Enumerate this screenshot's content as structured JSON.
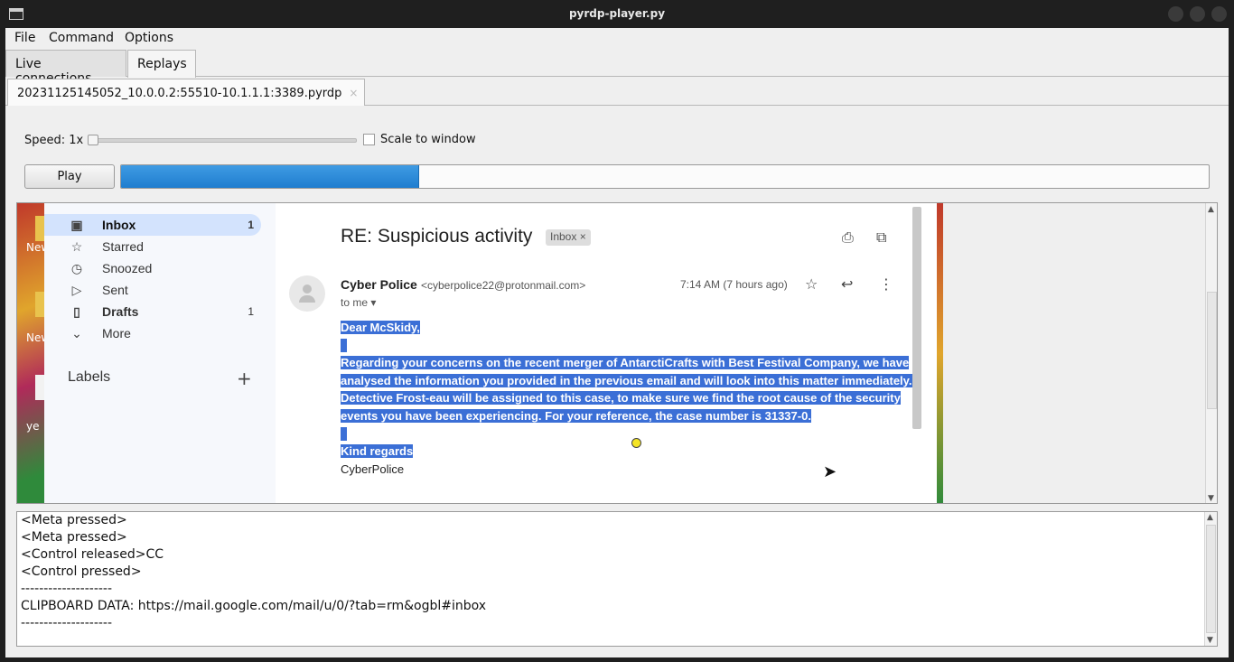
{
  "window": {
    "title": "pyrdp-player.py"
  },
  "menu": {
    "file": "File",
    "command": "Command",
    "options": "Options"
  },
  "tabs": {
    "live": "Live connections",
    "replays": "Replays"
  },
  "file_tab": {
    "name": "20231125145052_10.0.0.2:55510-10.1.1.1:3389.pyrdp",
    "close": "×"
  },
  "controls": {
    "speed_label": "Speed: 1x",
    "speed_value": 1,
    "scale_label": "Scale to window",
    "scale_checked": false,
    "play_label": "Play",
    "progress_fraction": 0.274
  },
  "gmail": {
    "nav": [
      {
        "label": "Inbox",
        "count": "1",
        "icon": "inbox-icon",
        "selected": true
      },
      {
        "label": "Starred",
        "count": "",
        "icon": "star-icon",
        "selected": false
      },
      {
        "label": "Snoozed",
        "count": "",
        "icon": "clock-icon",
        "selected": false
      },
      {
        "label": "Sent",
        "count": "",
        "icon": "send-icon",
        "selected": false
      },
      {
        "label": "Drafts",
        "count": "1",
        "icon": "draft-icon",
        "selected": false
      },
      {
        "label": "More",
        "count": "",
        "icon": "chevron-down-icon",
        "selected": false
      }
    ],
    "labels_title": "Labels",
    "subject": "RE: Suspicious activity",
    "chip": "Inbox",
    "sender_name": "Cyber Police",
    "sender_email": "<cyberpolice22@protonmail.com>",
    "to": "to me",
    "time": "7:14 AM (7 hours ago)",
    "body": {
      "greeting": "Dear McSkidy,",
      "p1": "Regarding your concerns on the recent merger of AntarctiCrafts with Best Festival Company, we have",
      "p2": "analysed the information you provided in the previous email and will look into this matter immediately.",
      "p3": "Detective Frost-eau will be assigned to this case, to make sure we find the root cause of the security",
      "p4": "events you have been experiencing. For your reference, the case number is 31337-0.",
      "closing": "Kind regards",
      "signature": "CyberPolice"
    }
  },
  "desktop": {
    "label1": "New",
    "label2": "New",
    "label3": "ye"
  },
  "log": [
    "<Meta pressed>",
    "<Meta pressed>",
    "<Control released>CC",
    "<Control pressed>",
    "--------------------",
    "CLIPBOARD DATA: https://mail.google.com/mail/u/0/?tab=rm&ogbl#inbox",
    "--------------------"
  ],
  "colors": {
    "selection": "#3b6fd6",
    "progress": "#2f8ddc",
    "inbox_selected": "#d3e3fd"
  }
}
